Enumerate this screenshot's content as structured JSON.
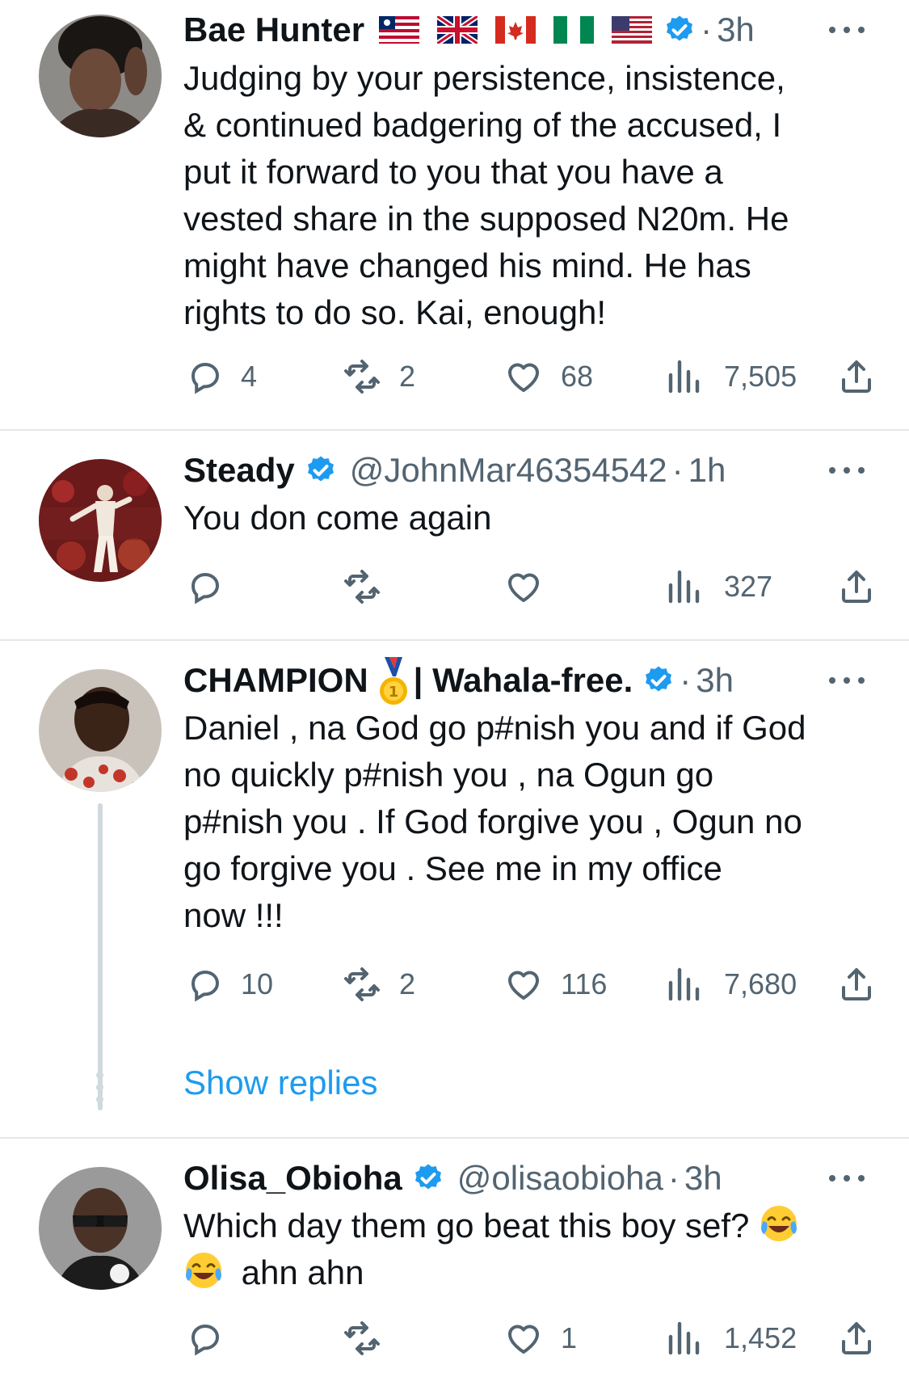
{
  "colors": {
    "accent": "#1d9bf0",
    "secondary_text": "#536471",
    "divider": "#e4e8eb"
  },
  "tweets": [
    {
      "display_name": "Bae Hunter",
      "flags": [
        "liberia-flag",
        "uk-flag",
        "canada-flag",
        "nigeria-flag",
        "usa-flag"
      ],
      "verified": true,
      "handle": "",
      "dot": "·",
      "time": "3h",
      "text": "Judging by your persistence, insistence,\n& continued badgering of the accused, I\nput it forward to you that you have a\nvested share in the supposed N20m. He\nmight have changed his mind. He has\nrights to do so. Kai, enough!",
      "replies": "4",
      "retweets": "2",
      "likes": "68",
      "views": "7,505"
    },
    {
      "display_name": "Steady",
      "verified": true,
      "handle": "@JohnMar46354542",
      "dot": "·",
      "time": "1h",
      "text": "You don come again",
      "replies": "",
      "retweets": "",
      "likes": "",
      "views": "327"
    },
    {
      "display_name": "CHAMPION",
      "display_name_suffix": "| Wahala-free.",
      "badge_icon": "gold-medal-icon",
      "verified": true,
      "handle": "",
      "dot": "·",
      "time": "3h",
      "text": "Daniel , na God go p#nish you and if God\nno quickly p#nish you , na Ogun go\np#nish you . If God forgive you , Ogun no\ngo forgive you . See me in my office\nnow !!!",
      "replies": "10",
      "retweets": "2",
      "likes": "116",
      "views": "7,680"
    },
    {
      "display_name": "Olisa_Obioha",
      "verified": true,
      "handle": "@olisaobioha",
      "dot": "·",
      "time": "3h",
      "text_line1": "Which day them go beat this boy sef?",
      "text_line2": "ahn ahn",
      "emoji_icon": "face-with-tears-of-joy-icon",
      "replies": "",
      "retweets": "",
      "likes": "1",
      "views": "1,452"
    }
  ],
  "show_replies_label": "Show replies"
}
